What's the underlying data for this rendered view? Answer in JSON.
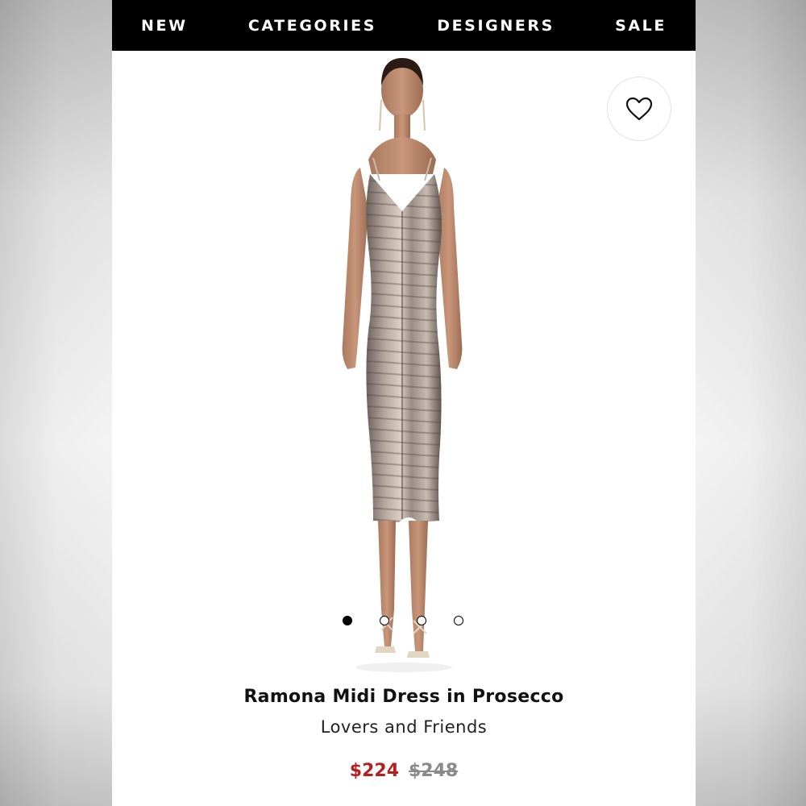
{
  "nav": {
    "items": [
      "NEW",
      "CATEGORIES",
      "DESIGNERS",
      "SALE"
    ]
  },
  "icons": {
    "favorite": "heart-outline-icon"
  },
  "gallery": {
    "image_count": 4,
    "active_index": 0
  },
  "product": {
    "name": "Ramona Midi Dress in Prosecco",
    "brand": "Lovers and Friends",
    "sale_price": "$224",
    "original_price": "$248"
  },
  "colors": {
    "nav_bg": "#000000",
    "sale_price": "#b32020",
    "original_price": "#8a8a8a"
  }
}
